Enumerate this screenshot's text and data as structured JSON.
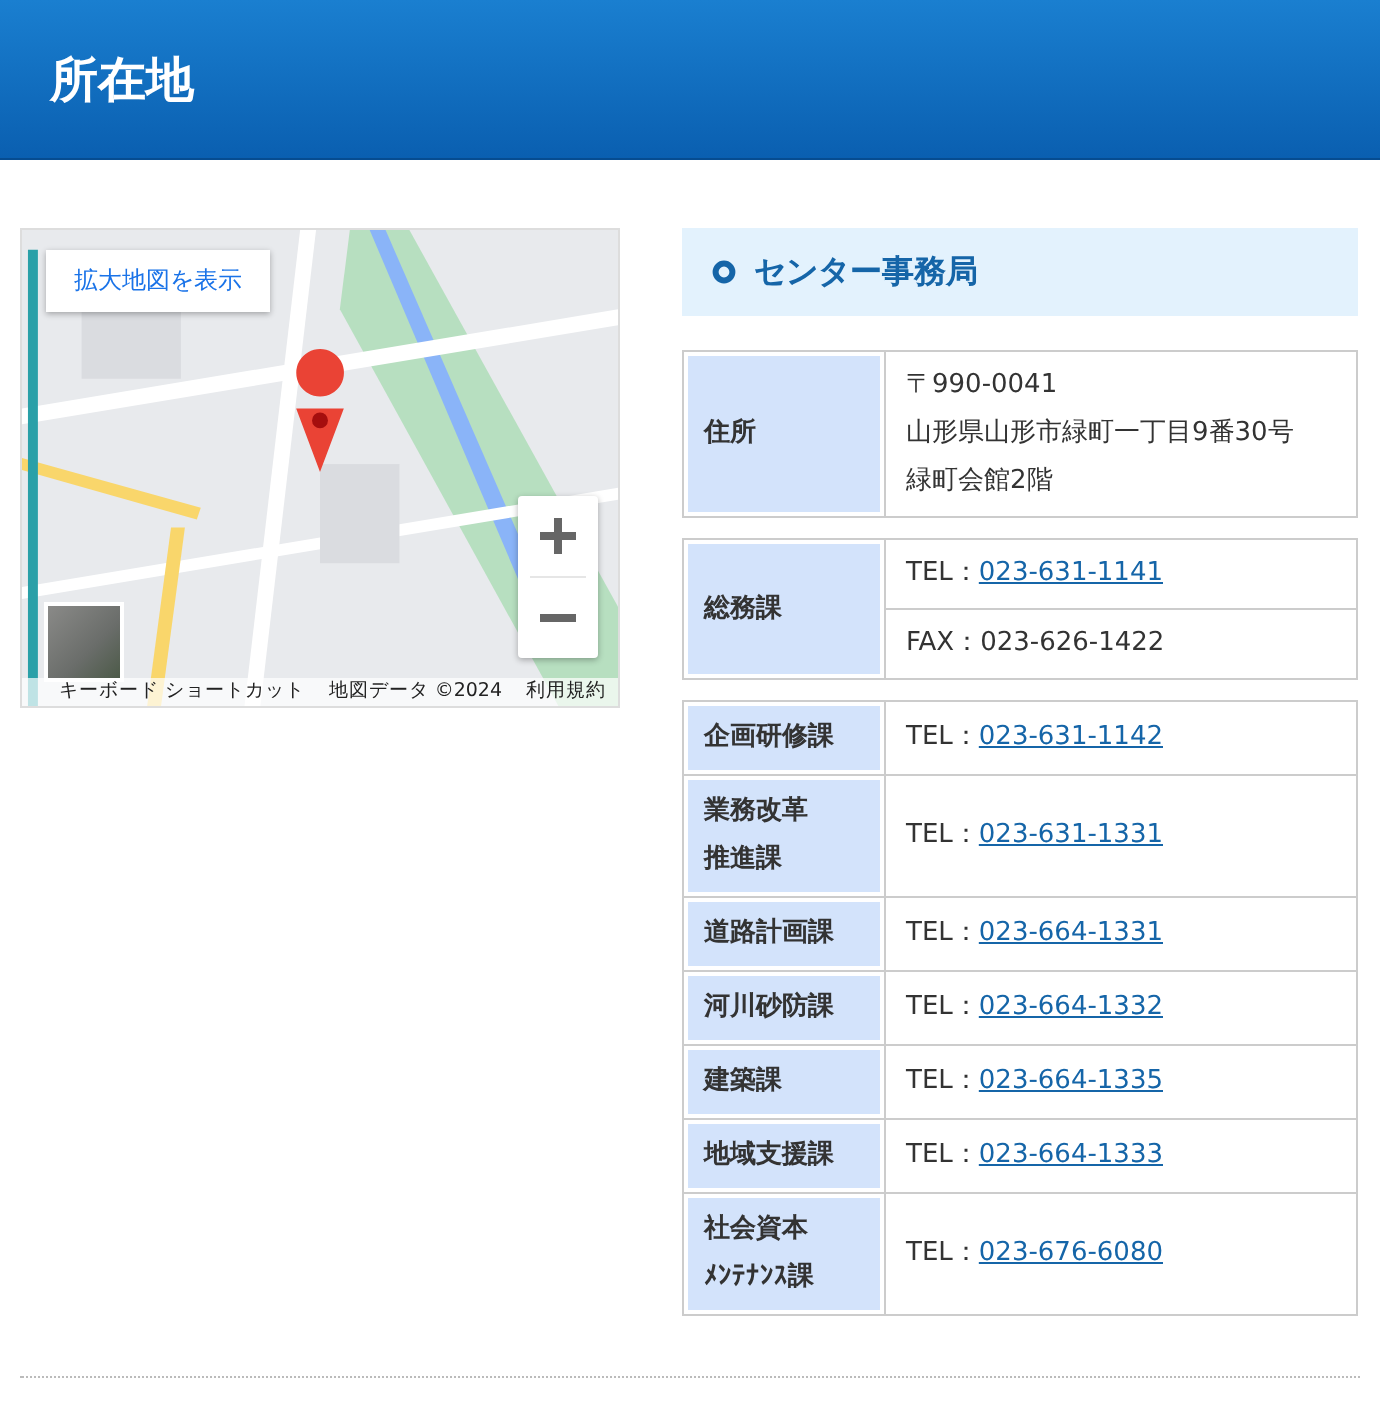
{
  "page_title": "所在地",
  "map": {
    "kind": "picture",
    "enlarge_link": "拡大地図を表示",
    "footer": [
      "キーボード ショートカット",
      "地図データ ©2024",
      "利用規約"
    ]
  },
  "section": {
    "title": "センター事務局"
  },
  "tables": [
    {
      "rows": [
        {
          "header": [
            "住所"
          ],
          "cells": [
            {
              "kind": "text",
              "lines": [
                "〒990-0041",
                "山形県山形市緑町一丁目9番30号",
                "緑町会館2階"
              ]
            }
          ]
        }
      ]
    },
    {
      "rows": [
        {
          "header": [
            "総務課"
          ],
          "cells": [
            {
              "kind": "phone",
              "label": "TEL：",
              "number": "023-631-1141"
            },
            {
              "kind": "text",
              "lines": [
                "FAX：023-626-1422"
              ]
            }
          ]
        }
      ]
    },
    {
      "rows": [
        {
          "header": [
            "企画研修課"
          ],
          "cells": [
            {
              "kind": "phone",
              "label": "TEL：",
              "number": "023-631-1142"
            }
          ]
        },
        {
          "header": [
            "業務改革",
            "推進課"
          ],
          "cells": [
            {
              "kind": "phone",
              "label": "TEL：",
              "number": "023-631-1331"
            }
          ]
        },
        {
          "header": [
            "道路計画課"
          ],
          "cells": [
            {
              "kind": "phone",
              "label": "TEL：",
              "number": "023-664-1331"
            }
          ]
        },
        {
          "header": [
            "河川砂防課"
          ],
          "cells": [
            {
              "kind": "phone",
              "label": "TEL：",
              "number": "023-664-1332"
            }
          ]
        },
        {
          "header": [
            "建築課"
          ],
          "cells": [
            {
              "kind": "phone",
              "label": "TEL：",
              "number": "023-664-1335"
            }
          ]
        },
        {
          "header": [
            "地域支援課"
          ],
          "cells": [
            {
              "kind": "phone",
              "label": "TEL：",
              "number": "023-664-1333"
            }
          ]
        },
        {
          "header": [
            "社会資本",
            "ﾒﾝﾃﾅﾝｽ課"
          ],
          "cells": [
            {
              "kind": "phone",
              "label": "TEL：",
              "number": "023-676-6080"
            }
          ]
        }
      ]
    }
  ]
}
